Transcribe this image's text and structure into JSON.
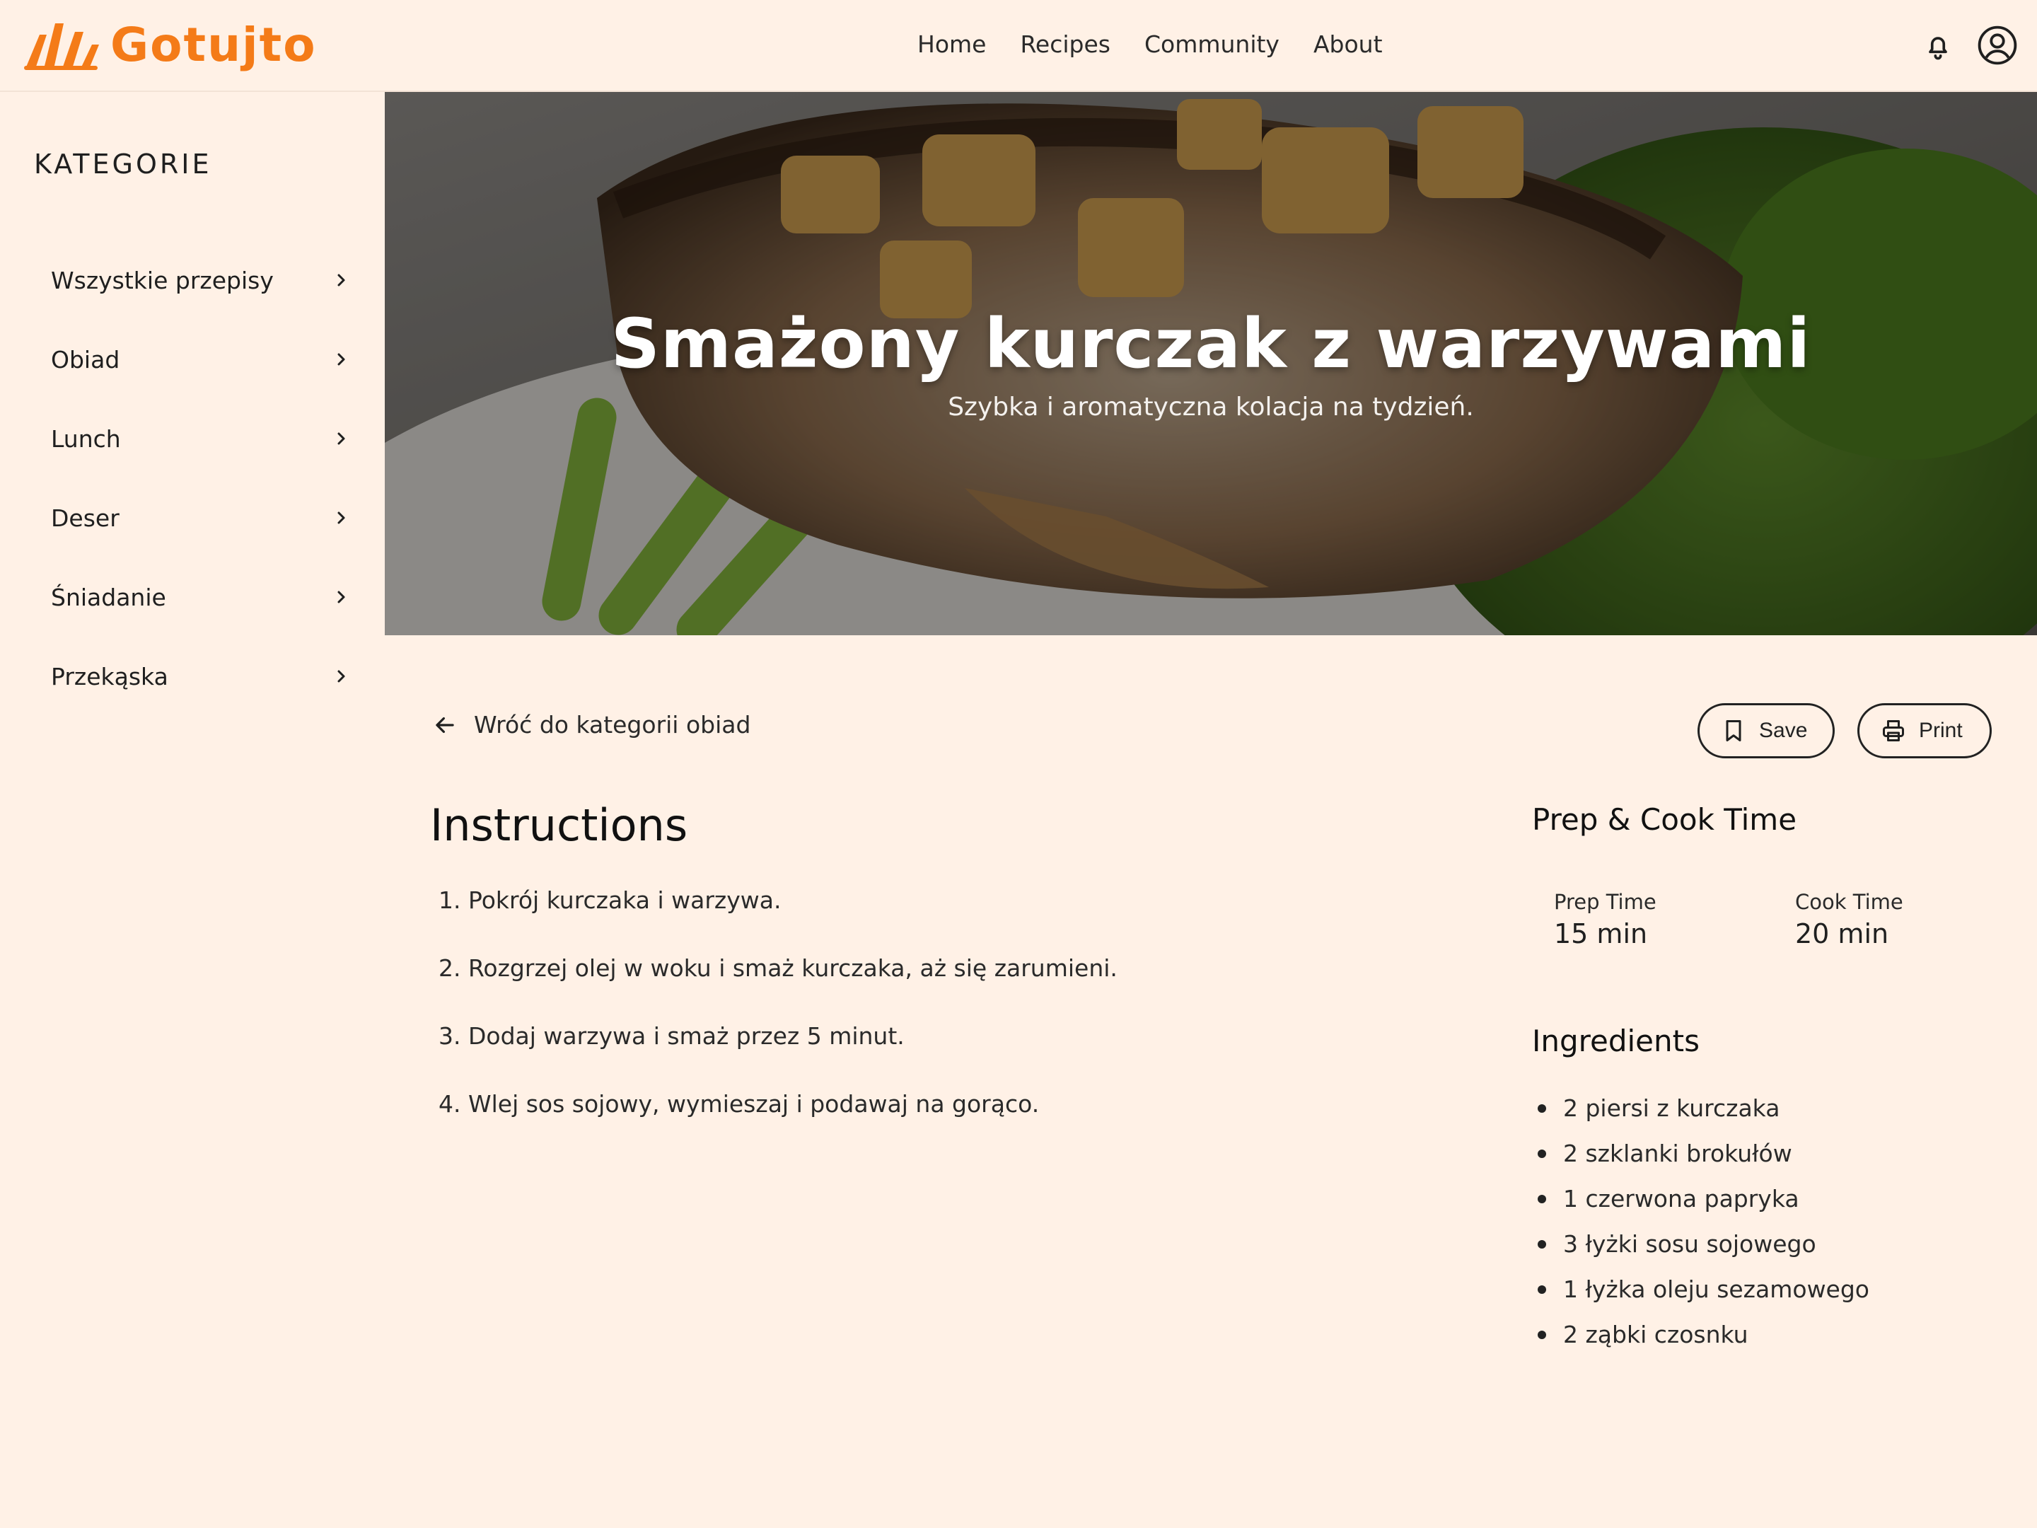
{
  "header": {
    "brand": "Gotujto",
    "nav": [
      "Home",
      "Recipes",
      "Community",
      "About"
    ],
    "icons": {
      "notifications": "bell-icon",
      "account": "user-circle-icon"
    }
  },
  "sidebar": {
    "title": "KATEGORIE",
    "items": [
      {
        "label": "Wszystkie przepisy"
      },
      {
        "label": "Obiad"
      },
      {
        "label": "Lunch"
      },
      {
        "label": "Deser"
      },
      {
        "label": "Śniadanie"
      },
      {
        "label": "Przekąska"
      }
    ]
  },
  "hero": {
    "title": "Smażony kurczak z warzywami",
    "subtitle": "Szybka i aromatyczna kolacja na tydzień."
  },
  "actions": {
    "back": "Wróć do kategorii obiad",
    "save": "Save",
    "print": "Print"
  },
  "instructions": {
    "title": "Instructions",
    "steps": [
      "1. Pokrój kurczaka i warzywa.",
      "2. Rozgrzej olej w woku i smaż kurczaka, aż się zarumieni.",
      "3. Dodaj warzywa i smaż przez 5 minut.",
      "4. Wlej sos sojowy, wymieszaj i podawaj na gorąco."
    ]
  },
  "prep_cook": {
    "title": "Prep & Cook Time",
    "prep_label": "Prep Time",
    "prep_value": "15 min",
    "cook_label": "Cook Time",
    "cook_value": "20 min"
  },
  "ingredients": {
    "title": "Ingredients",
    "items": [
      "2 piersi z kurczaka",
      "2 szklanki brokułów",
      "1 czerwona papryka",
      "3 łyżki sosu sojowego",
      "1 łyżka oleju sezamowego",
      "2 ząbki czosnku"
    ]
  },
  "colors": {
    "brand": "#f47b18",
    "background": "#fff1e6",
    "text": "#1f1f1f"
  }
}
